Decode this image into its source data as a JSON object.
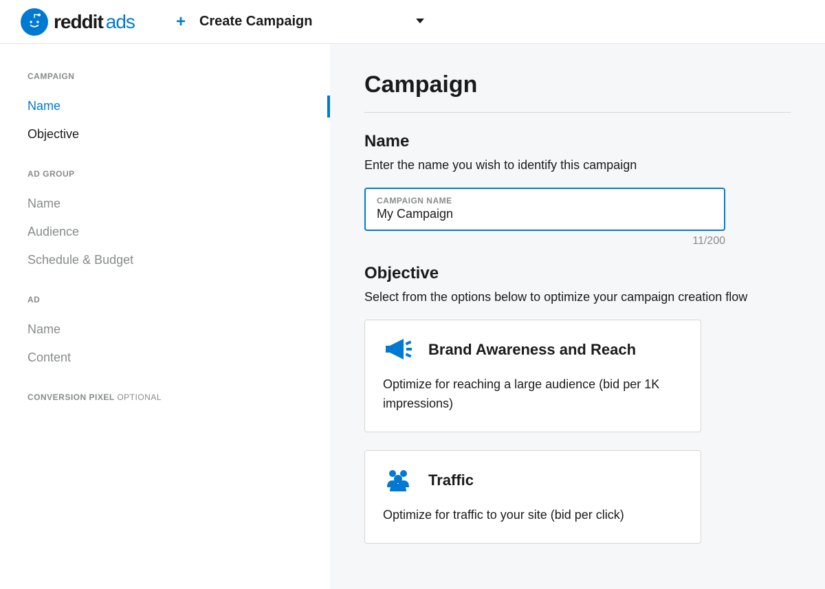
{
  "header": {
    "logo_text_reddit": "reddit",
    "logo_text_ads": "ads",
    "create_campaign_label": "Create Campaign"
  },
  "sidebar": {
    "sections": [
      {
        "heading": "CAMPAIGN",
        "items": [
          {
            "label": "Name",
            "active": true,
            "enabled": true
          },
          {
            "label": "Objective",
            "active": false,
            "enabled": true
          }
        ]
      },
      {
        "heading": "AD GROUP",
        "items": [
          {
            "label": "Name",
            "active": false,
            "enabled": false
          },
          {
            "label": "Audience",
            "active": false,
            "enabled": false
          },
          {
            "label": "Schedule & Budget",
            "active": false,
            "enabled": false
          }
        ]
      },
      {
        "heading": "AD",
        "items": [
          {
            "label": "Name",
            "active": false,
            "enabled": false
          },
          {
            "label": "Content",
            "active": false,
            "enabled": false
          }
        ]
      },
      {
        "heading": "CONVERSION PIXEL",
        "optional": "OPTIONAL",
        "items": []
      }
    ]
  },
  "content": {
    "title": "Campaign",
    "name_section": {
      "title": "Name",
      "description": "Enter the name you wish to identify this campaign",
      "input_label": "CAMPAIGN NAME",
      "input_value": "My Campaign",
      "char_count": "11/200"
    },
    "objective_section": {
      "title": "Objective",
      "description": "Select from the options below to optimize your campaign creation flow",
      "options": [
        {
          "title": "Brand Awareness and Reach",
          "description": "Optimize for reaching a large audience (bid per 1K impressions)"
        },
        {
          "title": "Traffic",
          "description": "Optimize for traffic to your site (bid per click)"
        }
      ]
    }
  }
}
